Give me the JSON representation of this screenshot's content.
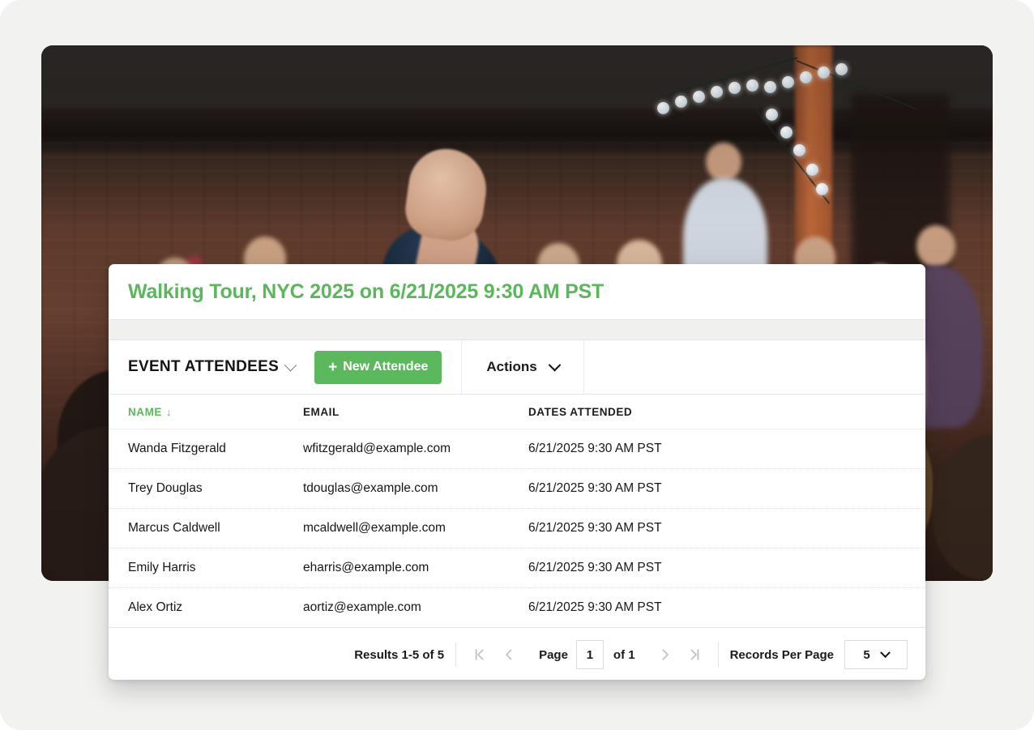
{
  "hero": {
    "alt": "crowd of people outdoors at an evening event with string lights"
  },
  "card": {
    "title": "Walking Tour, NYC 2025 on 6/21/2025 9:30 AM PST"
  },
  "toolbar": {
    "list_title": "EVENT ATTENDEES",
    "list_caret_icon": "chevron-down-icon",
    "new_button_plus": "+",
    "new_button_label": "New Attendee",
    "actions_label": "Actions",
    "actions_caret_icon": "chevron-down-icon"
  },
  "table": {
    "columns": [
      {
        "label": "NAME",
        "sorted": true,
        "sort_icon": "↓"
      },
      {
        "label": "EMAIL",
        "sorted": false,
        "sort_icon": ""
      },
      {
        "label": "DATES ATTENDED",
        "sorted": false,
        "sort_icon": ""
      }
    ],
    "rows": [
      {
        "name": "Wanda Fitzgerald",
        "email": "wfitzgerald@example.com",
        "dates": "6/21/2025 9:30 AM PST"
      },
      {
        "name": "Trey Douglas",
        "email": "tdouglas@example.com",
        "dates": "6/21/2025 9:30 AM PST"
      },
      {
        "name": "Marcus Caldwell",
        "email": "mcaldwell@example.com",
        "dates": "6/21/2025 9:30 AM PST"
      },
      {
        "name": "Emily Harris",
        "email": "eharris@example.com",
        "dates": "6/21/2025 9:30 AM PST"
      },
      {
        "name": "Alex Ortiz",
        "email": "aortiz@example.com",
        "dates": "6/21/2025 9:30 AM PST"
      }
    ]
  },
  "footer": {
    "results_text": "Results 1-5 of 5",
    "first_page_icon": "first-page-icon",
    "prev_page_icon": "previous-page-icon",
    "next_page_icon": "next-page-icon",
    "last_page_icon": "last-page-icon",
    "page_label": "Page",
    "page_value": "1",
    "page_of": "of 1",
    "records_per_page_label": "Records Per Page",
    "records_per_page_value": "5"
  },
  "colors": {
    "brand_green": "#5cb85c",
    "title_green": "#5bb75b",
    "text_dark": "#161616",
    "disabled_grey": "#c4c4c4",
    "band_grey": "#f0f0ef",
    "page_bg": "#f2f2f1"
  }
}
